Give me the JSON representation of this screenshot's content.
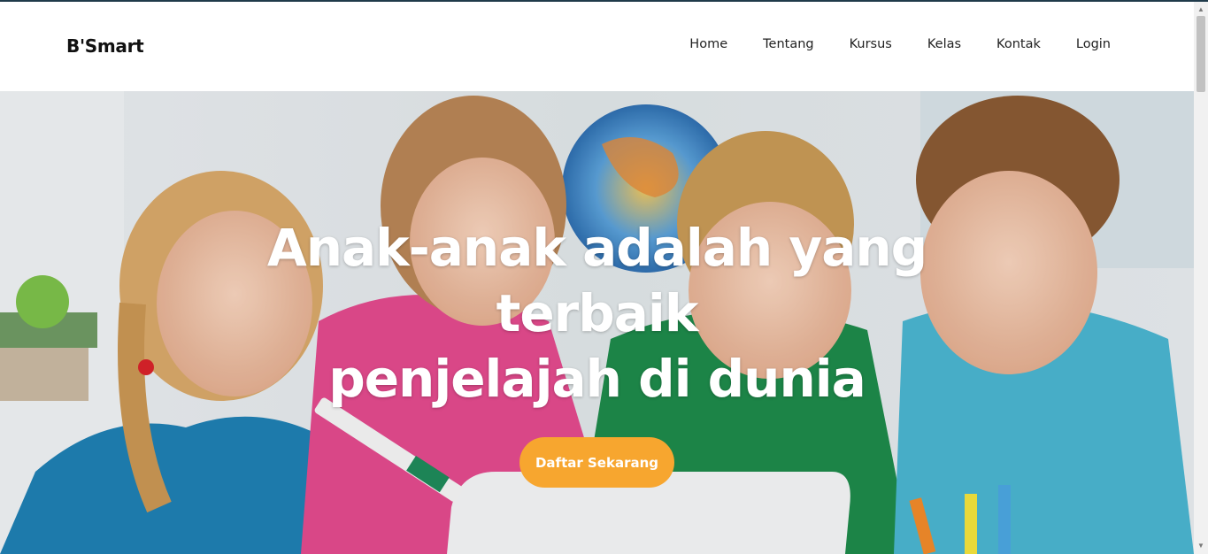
{
  "brand": {
    "name": "B'Smart"
  },
  "nav": {
    "items": [
      {
        "label": "Home"
      },
      {
        "label": "Tentang"
      },
      {
        "label": "Kursus"
      },
      {
        "label": "Kelas"
      },
      {
        "label": "Kontak"
      },
      {
        "label": "Login"
      }
    ]
  },
  "hero": {
    "headline_lines": [
      "Anak-anak adalah yang",
      "terbaik",
      "penjelajah di dunia"
    ],
    "cta_label": "Daftar Sekarang",
    "image_description_icon": "children-photo"
  },
  "colors": {
    "accent": "#f7a62f",
    "text_dark": "#111111",
    "headline": "#ffffff",
    "topline": "#1f3a4a"
  }
}
